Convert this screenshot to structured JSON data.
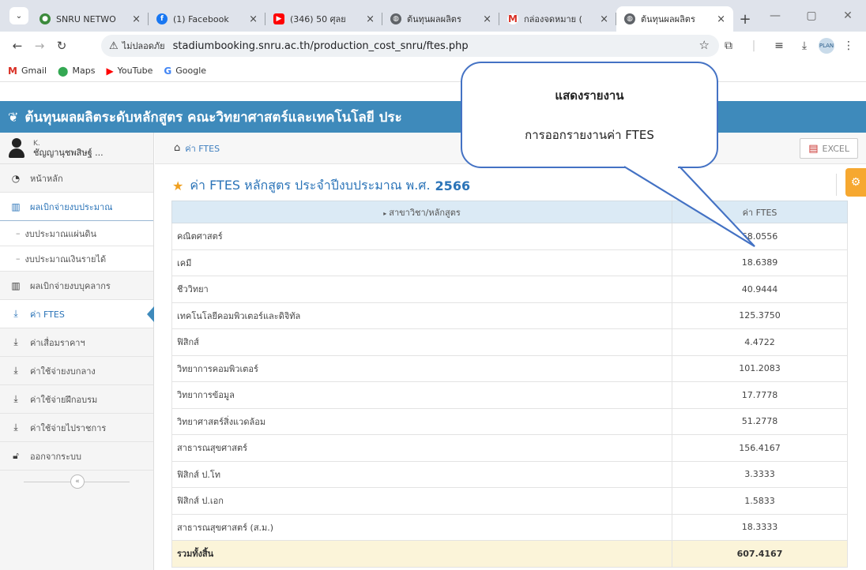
{
  "browser": {
    "tabs": [
      {
        "title": "SNRU NETWO",
        "favicon": "snru",
        "color": "#3c8a3c"
      },
      {
        "title": "(1) Facebook",
        "favicon": "facebook",
        "color": "#1877f2"
      },
      {
        "title": "(346) 50 ศุลย",
        "favicon": "youtube",
        "color": "#ff0000"
      },
      {
        "title": "ต้นทุนผลผลิตร",
        "favicon": "globe",
        "color": "#5f6368"
      },
      {
        "title": "กล่องจดหมาย (",
        "favicon": "gmail",
        "color": "#d93025"
      },
      {
        "title": "ต้นทุนผลผลิตร",
        "favicon": "globe",
        "color": "#5f6368"
      }
    ],
    "security_label": "ไม่ปลอดภัย",
    "url": "stadiumbooking.snru.ac.th/production_cost_snru/ftes.php",
    "profile_label": "PLAN",
    "bookmarks": [
      {
        "label": "Gmail",
        "icon": "gmail-icon"
      },
      {
        "label": "Maps",
        "icon": "maps-icon"
      },
      {
        "label": "YouTube",
        "icon": "youtube-icon"
      },
      {
        "label": "Google",
        "icon": "google-icon"
      }
    ]
  },
  "app": {
    "header_title": "ต้นทุนผลผลิตระดับหลักสูตร คณะวิทยาศาสตร์และเทคโนโลยี ประ",
    "user": {
      "small": "K.",
      "name": "ชัญญานุชพสิษฐ์ ..."
    },
    "menu": [
      {
        "label": "หน้าหลัก",
        "icon": "dashboard-icon",
        "type": "item"
      },
      {
        "label": "ผลเบิกจ่ายงบประมาณ",
        "icon": "bar-chart-icon",
        "type": "open"
      },
      {
        "label": "งบประมาณแผ่นดิน",
        "type": "sub"
      },
      {
        "label": "งบประมาณเงินรายได้",
        "type": "sub"
      },
      {
        "label": "ผลเบิกจ่ายงบบุคลากร",
        "icon": "bar-chart-icon",
        "type": "item"
      },
      {
        "label": "ค่า FTES",
        "icon": "download-icon",
        "type": "active"
      },
      {
        "label": "ค่าเสื่อมราคาฯ",
        "icon": "download-icon",
        "type": "item"
      },
      {
        "label": "ค่าใช้จ่ายงบกลาง",
        "icon": "download-icon",
        "type": "item"
      },
      {
        "label": "ค่าใช้จ่ายฝึกอบรม",
        "icon": "download-icon",
        "type": "item"
      },
      {
        "label": "ค่าใช้จ่ายไปราชการ",
        "icon": "download-icon",
        "type": "item"
      },
      {
        "label": "ออกจากระบบ",
        "icon": "unlock-icon",
        "type": "item"
      }
    ],
    "breadcrumb": "ค่า FTES",
    "excel_label": "EXCEL",
    "page_title_prefix": "ค่า FTES หลักสูตร ประจำปีงบประมาณ พ.ศ.",
    "page_title_year": "2566",
    "table": {
      "headers": [
        "สาขาวิชา/หลักสูตร",
        "ค่า FTES"
      ],
      "rows": [
        [
          "คณิตศาสตร์",
          "68.0556"
        ],
        [
          "เคมี",
          "18.6389"
        ],
        [
          "ชีววิทยา",
          "40.9444"
        ],
        [
          "เทคโนโลยีคอมพิวเตอร์และดิจิทัล",
          "125.3750"
        ],
        [
          "ฟิสิกส์",
          "4.4722"
        ],
        [
          "วิทยาการคอมพิวเตอร์",
          "101.2083"
        ],
        [
          "วิทยาการข้อมูล",
          "17.7778"
        ],
        [
          "วิทยาศาสตร์สิ่งแวดล้อม",
          "51.2778"
        ],
        [
          "สาธารณสุขศาสตร์",
          "156.4167"
        ],
        [
          "ฟิสิกส์ ป.โท",
          "3.3333"
        ],
        [
          "ฟิสิกส์ ป.เอก",
          "1.5833"
        ],
        [
          "สาธารณสุขศาสตร์ (ส.ม.)",
          "18.3333"
        ]
      ],
      "total": [
        "รวมทั้งสิ้น",
        "607.4167"
      ]
    }
  },
  "callout": {
    "line1": "แสดงรายงาน",
    "line2": "การออกรายงานค่า FTES"
  }
}
